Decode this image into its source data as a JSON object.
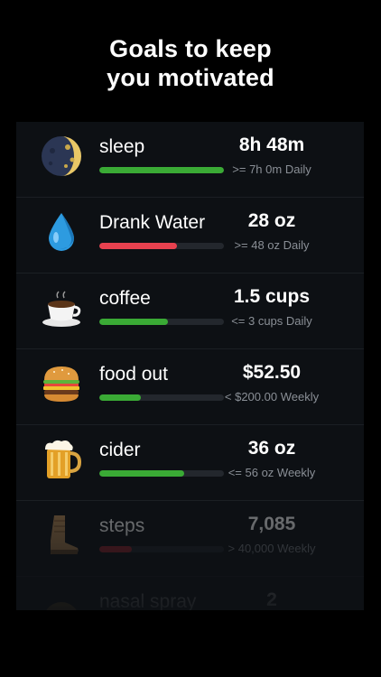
{
  "headline": {
    "line1": "Goals to keep",
    "line2": "you motivated"
  },
  "colors": {
    "green": "#3aaa35",
    "red": "#e8414f",
    "dark_red": "#a3262f",
    "track": "#23272d"
  },
  "goals": [
    {
      "name": "sleep",
      "value": "8h 48m",
      "goal": ">= 7h 0m Daily",
      "icon": "moon-icon",
      "progress": 1.0,
      "color": "#3aaa35"
    },
    {
      "name": "Drank Water",
      "value": "28 oz",
      "goal": ">= 48 oz Daily",
      "icon": "water-drop-icon",
      "progress": 0.62,
      "color": "#e8414f"
    },
    {
      "name": "coffee",
      "value": "1.5 cups",
      "goal": "<= 3 cups Daily",
      "icon": "coffee-cup-icon",
      "progress": 0.55,
      "color": "#3aaa35"
    },
    {
      "name": "food out",
      "value": "$52.50",
      "goal": "< $200.00 Weekly",
      "icon": "burger-icon",
      "progress": 0.33,
      "color": "#3aaa35"
    },
    {
      "name": "cider",
      "value": "36 oz",
      "goal": "<= 56 oz Weekly",
      "icon": "beer-mug-icon",
      "progress": 0.68,
      "color": "#3aaa35"
    },
    {
      "name": "steps",
      "value": "7,085",
      "goal": "> 40,000 Weekly",
      "icon": "boot-icon",
      "progress": 0.26,
      "color": "#a3262f"
    },
    {
      "name": "nasal spray",
      "value": "2",
      "goal": "",
      "icon": "nasal-spray-icon",
      "progress": 0,
      "color": "#3aaa35"
    }
  ]
}
